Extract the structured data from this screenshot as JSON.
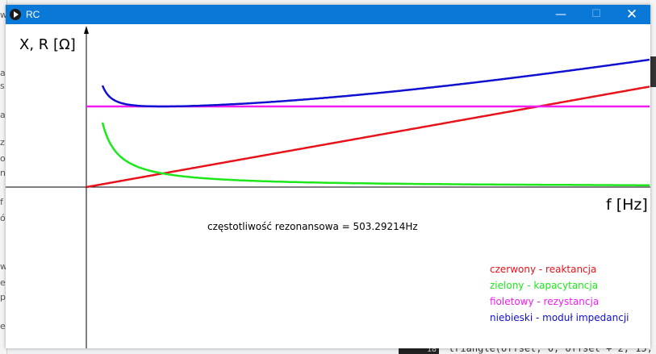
{
  "window": {
    "title": "RC"
  },
  "background": {
    "left_fragments": [
      "w",
      "a",
      "s",
      "a",
      "z",
      "o",
      "n",
      "f",
      "ó",
      "w",
      "e",
      "p",
      "e"
    ],
    "bottom_line_number": "18",
    "bottom_code": "triangle(offset, 0, offset + 2, 15,"
  },
  "chart_data": {
    "type": "line",
    "xlabel": "f [Hz]",
    "ylabel": "X, R [Ω]",
    "grid": false,
    "annotations": [
      "częstotliwość rezonansowa = 503.29214Hz"
    ],
    "series": [
      {
        "name": "czerwony - reaktancja",
        "color": "#e8121a",
        "shape": "linear-increasing"
      },
      {
        "name": "zielony - kapacytancja",
        "color": "#1ee81c",
        "shape": "inverse-decreasing"
      },
      {
        "name": "fioletowy - rezystancja",
        "color": "#f01cf0",
        "shape": "constant"
      },
      {
        "name": "niebieski - moduł impedancji",
        "color": "#1010d0",
        "shape": "sqrt-of-sum-of-squares"
      }
    ]
  },
  "legend": [
    {
      "label": "czerwony - reaktancja",
      "color": "#e8121a"
    },
    {
      "label": "zielony - kapacytancja",
      "color": "#1ee81c"
    },
    {
      "label": "fioletowy - rezystancja",
      "color": "#f01cf0"
    },
    {
      "label": "niebieski - moduł impedancji",
      "color": "#1010d0"
    }
  ]
}
